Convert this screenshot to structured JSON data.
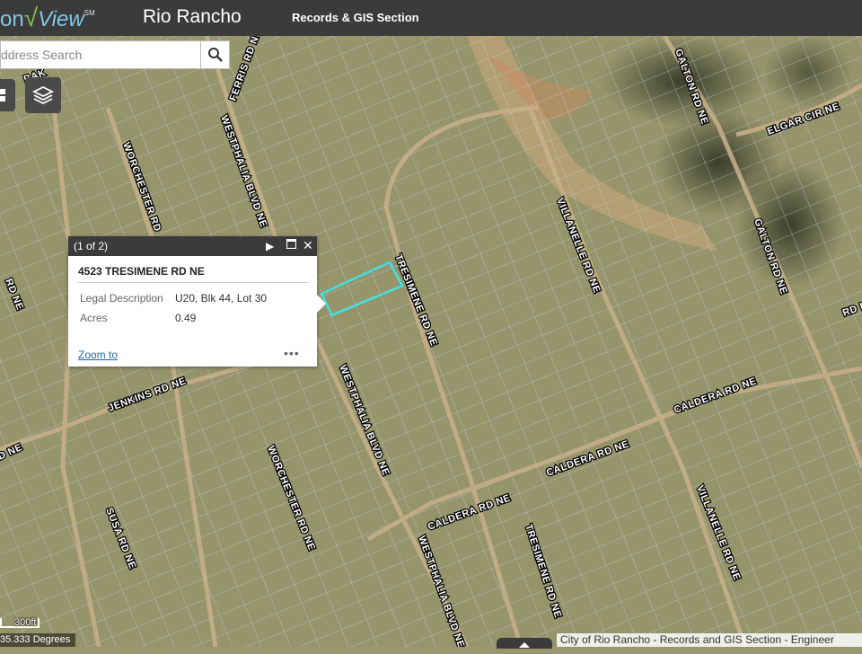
{
  "header": {
    "logo_prefix": "on",
    "logo_main": "View",
    "logo_sm": "SM",
    "city": "Rio Rancho",
    "section": "Records & GIS Section"
  },
  "search": {
    "placeholder": "ddress Search"
  },
  "popup": {
    "count": "(1 of 2)",
    "title": "4523 TRESIMENE RD NE",
    "fields": [
      {
        "label": "Legal Description",
        "value": "U20, Blk 44, Lot 30"
      },
      {
        "label": "Acres",
        "value": "0.49"
      }
    ],
    "zoom_link": "Zoom to",
    "more": "•••"
  },
  "roads": [
    "FERRIS RD NE",
    "WESTPHALIA BLVD NE",
    "WORCHESTER RD",
    "GALTON RD NE",
    "ELGAR CIR NE",
    "GALTON RD NE",
    "VILLANELLE RD NE",
    "TRESIMENE RD NE",
    "CALDERA RD NE",
    "CALDERA RD NE",
    "CALDERA RD NE",
    "JENKINS RD NE",
    "WESTPHALIA BLVD NE",
    "WORCHESTER RD NE",
    "SUSA RD NE",
    "TRESIMENE RD NE",
    "WESTPHALIA BLVD NE",
    "VILLANELLE RD NE",
    "RD NE",
    "D NE",
    "RD NE",
    "BAK"
  ],
  "scale": "300ft",
  "coords": "35.333 Degrees",
  "attribution": "City of Rio Rancho - Records and GIS Section - Engineer",
  "colors": {
    "parcel_highlight": "#40e0e0",
    "parcel_lines": "#c8d4e8",
    "header": "#3b3b3b"
  }
}
